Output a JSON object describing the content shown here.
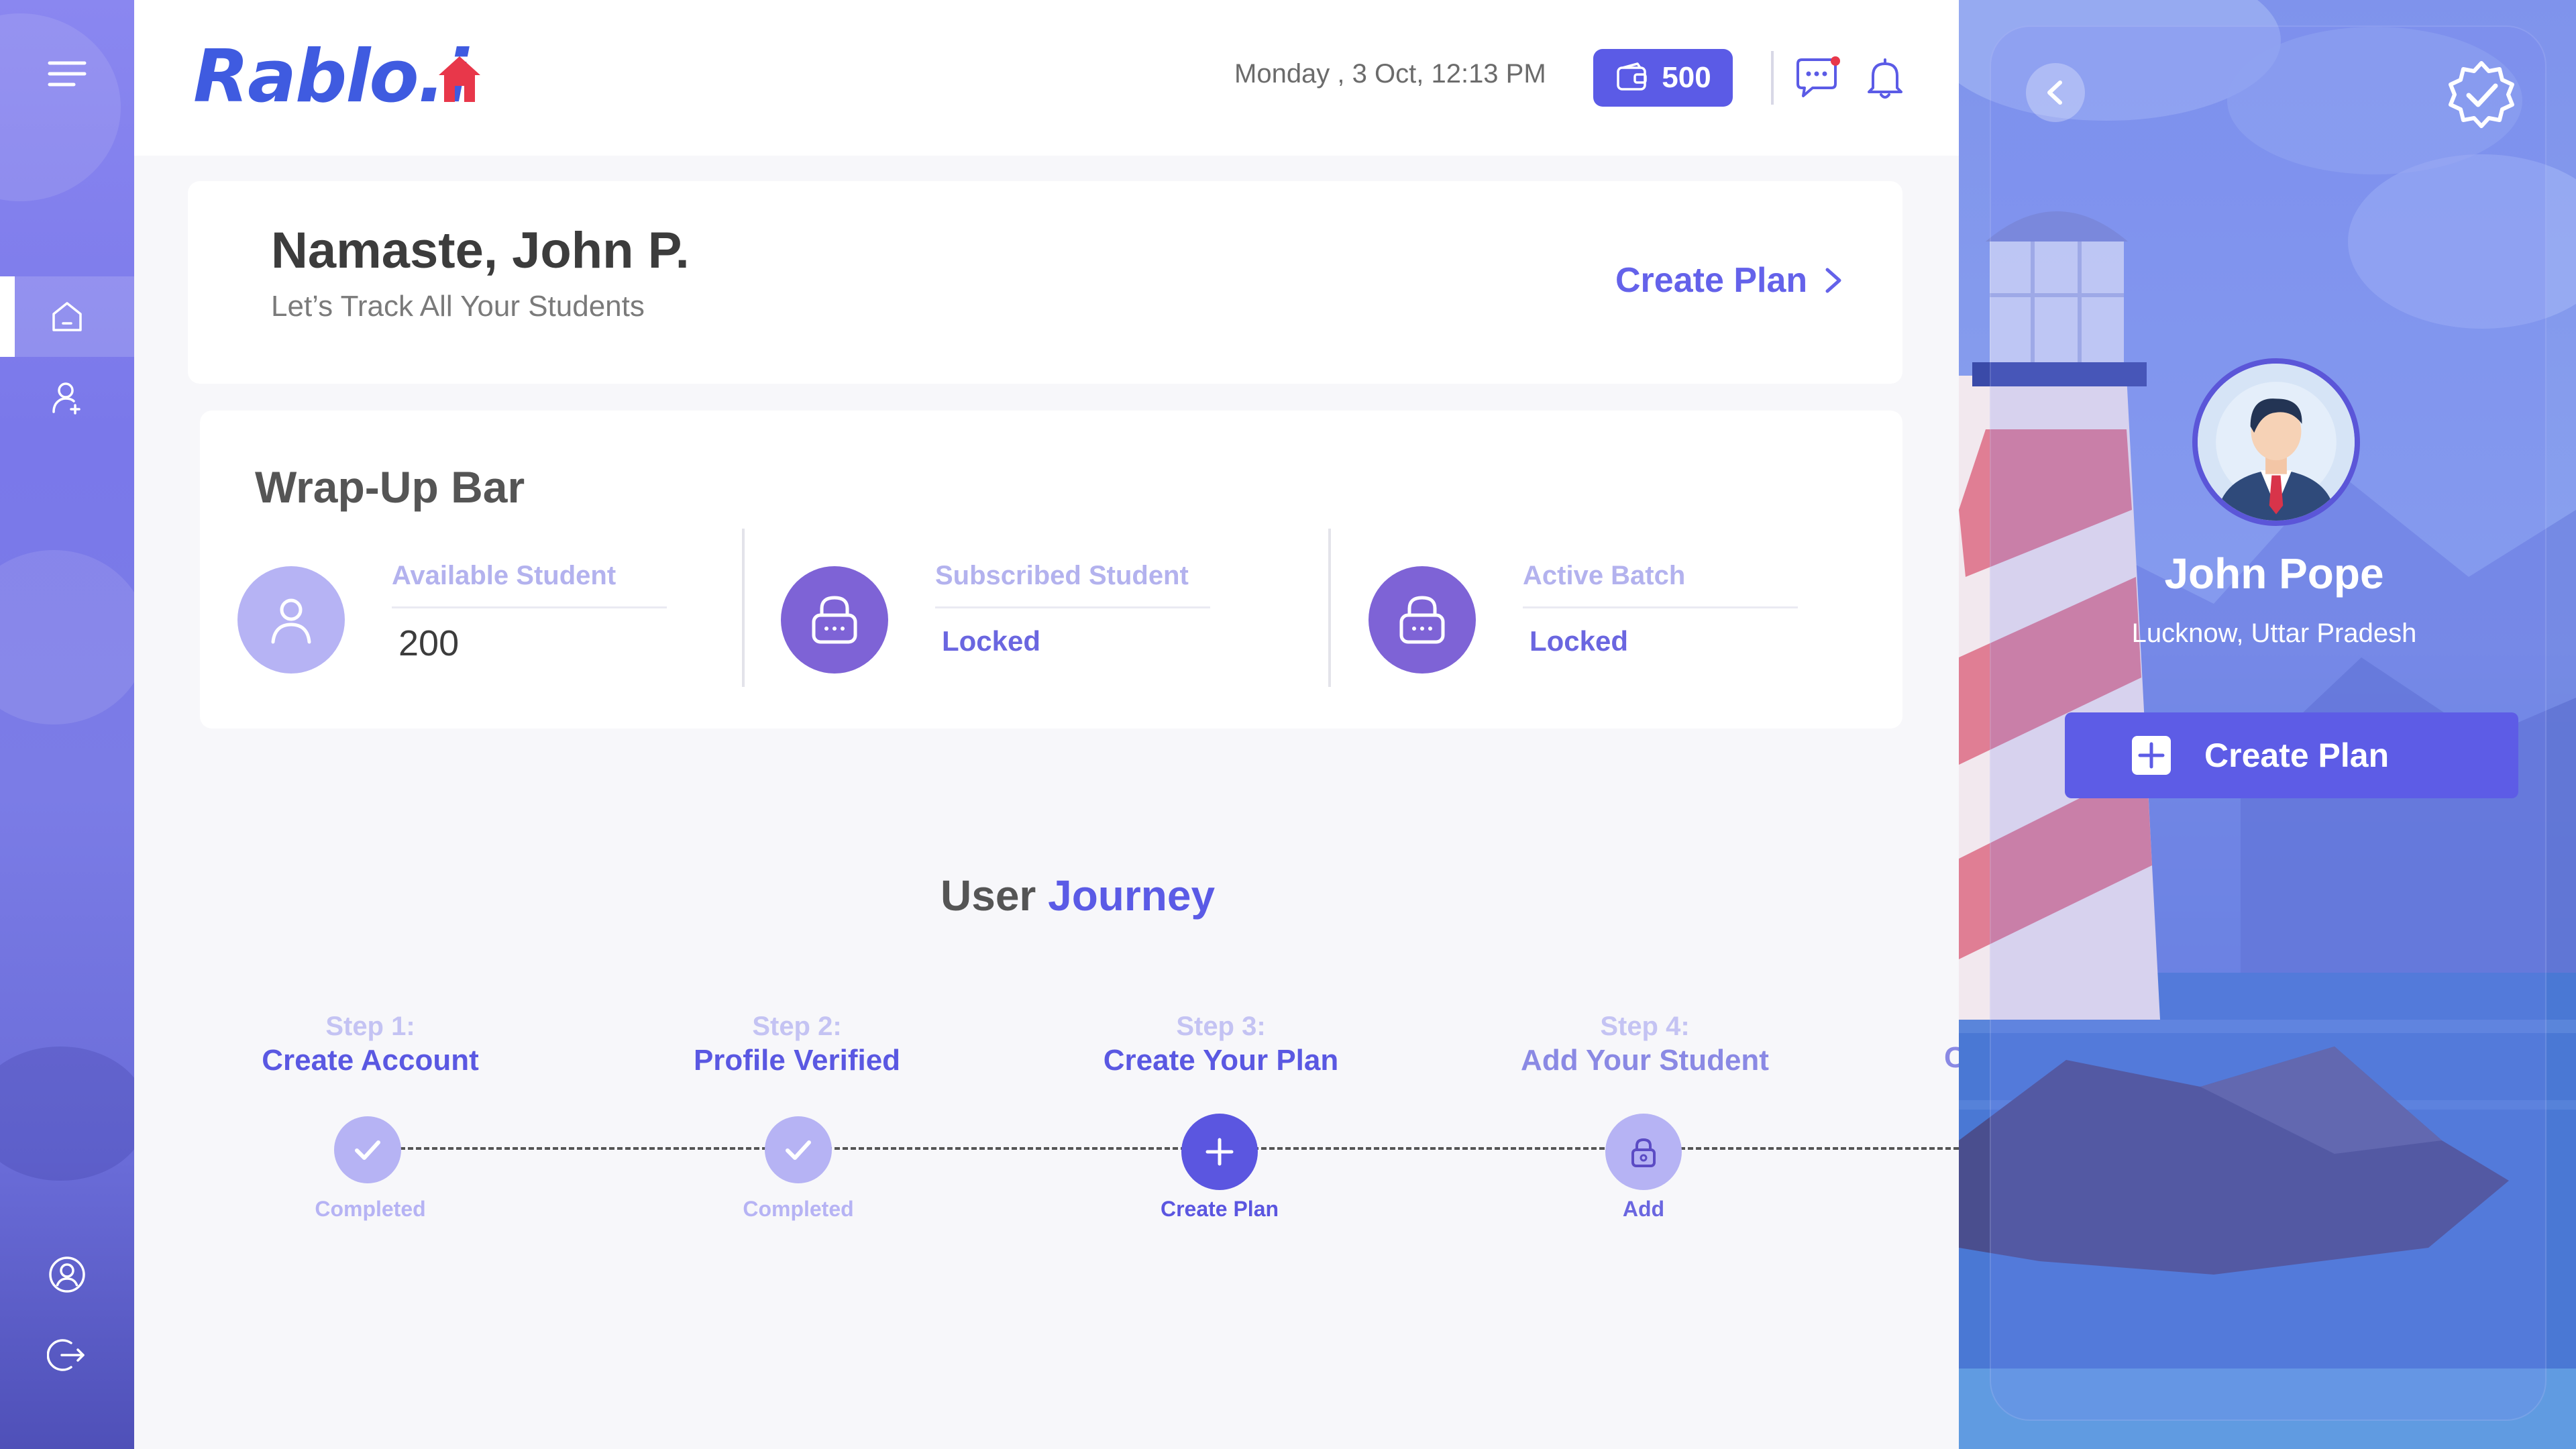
{
  "brand": {
    "logo_text": "Rablo.i",
    "logo_mark": "house-icon"
  },
  "header": {
    "datetime": "Monday , 3 Oct,  12:13 PM",
    "coins": "500",
    "coin_icon": "wallet-icon",
    "chat_icon": "chat-icon",
    "bell_icon": "bell-icon"
  },
  "sidebar": {
    "items": [
      {
        "icon": "menu-icon"
      },
      {
        "icon": "home-icon",
        "active": true
      },
      {
        "icon": "add-user-icon"
      },
      {
        "icon": "profile-icon"
      },
      {
        "icon": "logout-icon"
      }
    ]
  },
  "greeting": {
    "title": "Namaste, John P.",
    "subtitle": "Let’s Track All Your Students",
    "create_plan_link": "Create Plan"
  },
  "wrapup": {
    "title": "Wrap-Up Bar",
    "stats": [
      {
        "label": "Available Student",
        "value": "200",
        "icon": "user-icon"
      },
      {
        "label": "Subscribed Student",
        "value": "Locked",
        "icon": "lock-icon"
      },
      {
        "label": "Active Batch",
        "value": "Locked",
        "icon": "lock-icon"
      }
    ]
  },
  "journey": {
    "title_plain": "User",
    "title_accent": "Journey",
    "steps": [
      {
        "step": "Step 1:",
        "name": "Create Account",
        "status": "Completed"
      },
      {
        "step": "Step 2:",
        "name": "Profile Verified",
        "status": "Completed"
      },
      {
        "step": "Step 3:",
        "name": "Create Your Plan",
        "status": "Create Plan"
      },
      {
        "step": "Step 4:",
        "name": "Add Your Student",
        "status": "Add"
      }
    ],
    "partial_next": "C"
  },
  "profile": {
    "name": "John Pope",
    "location": "Lucknow, Uttar Pradesh",
    "create_plan_button": "Create Plan"
  },
  "colors": {
    "primary": "#5b5be6",
    "accent_red": "#e8374a",
    "sidebar_top": "#8a87f0",
    "sidebar_bottom": "#4f50b8",
    "completed_node": "#b6b3f4",
    "current_node": "#5b56e0",
    "locked_node": "#7e63d6"
  }
}
